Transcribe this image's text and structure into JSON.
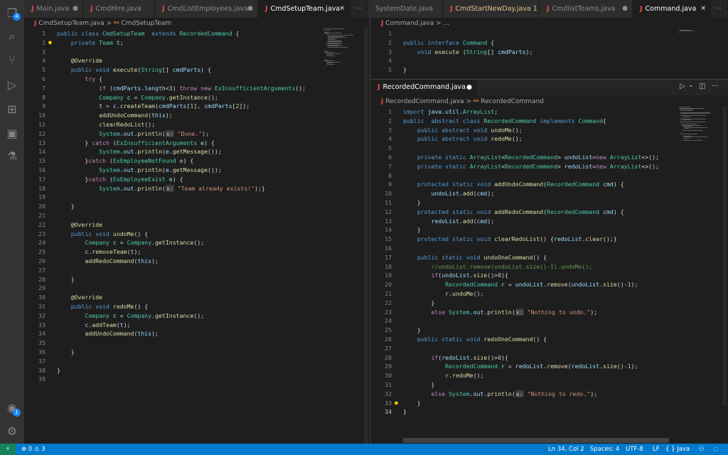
{
  "tabs": [
    {
      "label": "Main.java",
      "state": "●",
      "style": "normal"
    },
    {
      "label": "CmdHire.java",
      "state": "",
      "style": "normal"
    },
    {
      "label": "CmdListEmployees.java",
      "state": "●",
      "style": "normal"
    },
    {
      "label": "CmdSetupTeam.java",
      "state": "×",
      "style": "active"
    },
    {
      "label": "···",
      "state": "",
      "style": "normal"
    },
    {
      "label": "SystemDate.java",
      "state": "",
      "style": "normal"
    },
    {
      "label": "CmdStartNewDay.java 1",
      "state": "",
      "style": "yellow"
    },
    {
      "label": "CmdlistTeams.java",
      "state": "●",
      "style": "normal"
    },
    {
      "label": "Command.java",
      "state": "×",
      "style": "active"
    }
  ],
  "left": {
    "breadcrumb_file": "CmdSetupTeam.java",
    "breadcrumb_sep": ">",
    "breadcrumb_class": "CmdSetupTeam",
    "lines": [
      "public class CmdSetupTeam  extends RecordedCommand {",
      "    private Team t;",
      "",
      "    @Override",
      "    public void execute(String[] cmdParts) {",
      "        try {",
      "            if (cmdParts.length<3) throw new ExInsufficientArguments();",
      "            Company c = Company.getInstance();",
      "            t = c.createTeam(cmdParts[1], cmdParts[2]);",
      "            addUndoCommand(this);",
      "            clearRedoList();",
      "            System.out.println(x: \"Done.\");",
      "        } catch (ExInsufficientArguments e) {",
      "            System.out.println(e.getMessage());",
      "        }catch (ExEmployeeNotFound e) {",
      "            System.out.println(e.getMessage());",
      "        }catch (ExEmployeeExist e) {",
      "            System.out.println(x: \"Team already exists!\");}",
      "",
      "    }",
      "",
      "    @Override",
      "    public void undoMe() {",
      "        Company c = Company.getInstance();",
      "        c.removeTeam(t);",
      "        addRedoCommand(this);",
      "",
      "    }",
      "",
      "    @Override",
      "    public void redoMe() {",
      "        Company c = Company.getInstance();",
      "        c.addTeam(t);",
      "        addUndoCommand(this);",
      "",
      "    }",
      "",
      "}",
      ""
    ]
  },
  "top_right": {
    "breadcrumb_file": "Command.java",
    "breadcrumb_sep": "> ...",
    "lines": [
      "",
      "public interface Command {",
      "    void execute (String[] cmdParts);",
      "",
      "}"
    ]
  },
  "bottom_right": {
    "tab_label": "RecordedCommand.java",
    "tab_state": "●",
    "breadcrumb_file": "RecordedCommand.java",
    "breadcrumb_sep": ">",
    "breadcrumb_class": "RecordedCommand",
    "toolbar": {
      "run": "▷",
      "run_menu": "⌄",
      "split": "◫",
      "more": "···"
    },
    "lines": [
      "import java.util.ArrayList;",
      "public  abstract class RecordedCommand implements Command{",
      "    public abstract void undoMe();",
      "    public abstract void redoMe();",
      "",
      "    private static ArrayList<RecordedCommand> undoList=new ArrayList<>();",
      "    private static ArrayList<RecordedCommand> redoList=new ArrayList<>();",
      "",
      "    protected static void addUndoCommand(RecordedCommand cmd) {",
      "        undoList.add(cmd);",
      "    }",
      "    protected static void addRedoCommand(RecordedCommand cmd) {",
      "        redoList.add(cmd);",
      "    }",
      "    protected static void clearRedoList() {redoList.clear();}",
      "",
      "    public static void undoOneCommand() {",
      "        //undoList.remove(undoList.size()-1).undoMe();",
      "        if(undoList.size()>0){",
      "            RecordedCommand r = undoList.remove(undoList.size()-1);",
      "            r.undoMe();",
      "        }",
      "        else System.out.println(x: \"Nothing to undo.\");",
      "",
      "    }",
      "    public static void redoOneCommand() {",
      "",
      "        if(redoList.size()>0){",
      "            RecordedCommand r = redoList.remove(redoList.size()-1);",
      "            r.redoMe();",
      "        }",
      "        else System.out.println(x: \"Nothing to redo.\");",
      "    }",
      "}"
    ]
  },
  "activity_bar": {
    "explorer_badge": "4",
    "account_badge": "1",
    "icons": [
      "files-icon",
      "search-icon",
      "source-control-icon",
      "run-debug-icon",
      "extensions-icon",
      "remote-explorer-icon",
      "testing-icon",
      "account-icon",
      "settings-gear-icon"
    ]
  },
  "status": {
    "remote": "⚡",
    "problems": "⊗ 0 ⚠ 3",
    "position": "Ln 34, Col 2",
    "spaces": "Spaces: 4",
    "encoding": "UTF-8",
    "eol": "LF",
    "language": "{ } Java",
    "feedback": "⚇",
    "bell": "🔔"
  }
}
